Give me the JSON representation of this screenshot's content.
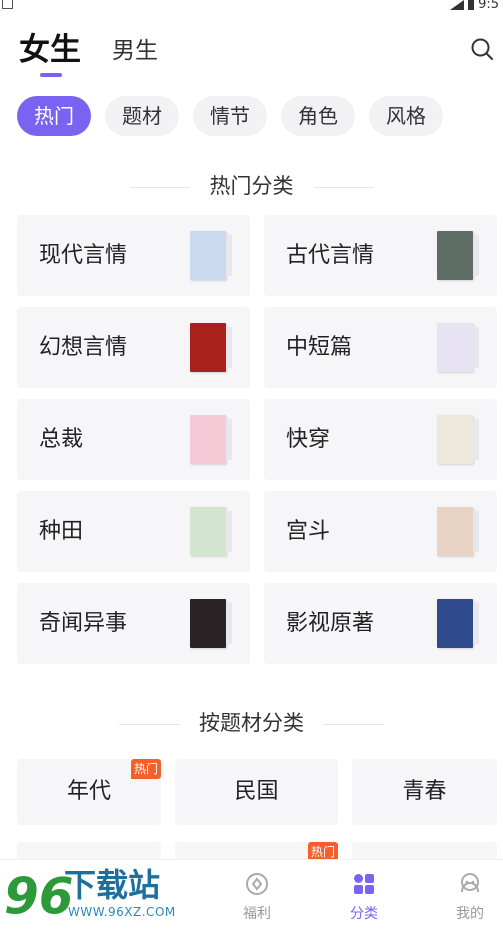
{
  "status": {
    "time": "9:5"
  },
  "gender_tabs": [
    {
      "label": "女生",
      "active": true
    },
    {
      "label": "男生",
      "active": false
    }
  ],
  "filter_chips": [
    {
      "label": "热门",
      "active": true
    },
    {
      "label": "题材",
      "active": false
    },
    {
      "label": "情节",
      "active": false
    },
    {
      "label": "角色",
      "active": false
    },
    {
      "label": "风格",
      "active": false
    }
  ],
  "hot_section": {
    "title": "热门分类",
    "items": [
      {
        "label": "现代言情",
        "cover_color": "#c9d9ee"
      },
      {
        "label": "古代言情",
        "cover_color": "#5e6d64"
      },
      {
        "label": "幻想言情",
        "cover_color": "#a8221b"
      },
      {
        "label": "中短篇",
        "cover_color": "#e7e3f3"
      },
      {
        "label": "总裁",
        "cover_color": "#f6c9d6"
      },
      {
        "label": "快穿",
        "cover_color": "#ece8dc"
      },
      {
        "label": "种田",
        "cover_color": "#d4e5cf"
      },
      {
        "label": "宫斗",
        "cover_color": "#e9d3c4"
      },
      {
        "label": "奇闻异事",
        "cover_color": "#2a2426"
      },
      {
        "label": "影视原著",
        "cover_color": "#2e4a8c"
      }
    ]
  },
  "theme_section": {
    "title": "按题材分类",
    "items": [
      {
        "label": "年代",
        "badge": "热门"
      },
      {
        "label": "民国",
        "badge": ""
      },
      {
        "label": "青春",
        "badge": ""
      }
    ],
    "next_row_badge": "热门"
  },
  "watermark": {
    "text": "下载站",
    "num": "96",
    "url": "WWW.96XZ.COM"
  },
  "tabbar": [
    {
      "label": "福利",
      "active": false
    },
    {
      "label": "分类",
      "active": true
    },
    {
      "label": "我的",
      "active": false
    }
  ],
  "colors": {
    "accent": "#7b63f2",
    "hot_badge": "#f5602a",
    "card_bg": "#f6f6f8"
  }
}
